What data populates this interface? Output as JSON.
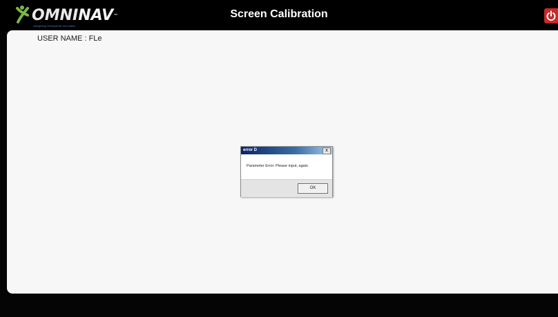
{
  "header": {
    "logo_text_a": "OMNI",
    "logo_text_b": "NAV",
    "logo_tm": "™",
    "logo_tagline": "Navigating Orthopaedic Innovation",
    "title": "Screen Calibration",
    "power_icon": "power-icon"
  },
  "main": {
    "user_label": "USER NAME : FLe"
  },
  "dialog": {
    "title": "error D",
    "close_label": "x",
    "message": "Parameter Error. Please input, again",
    "ok_label": "OK"
  },
  "colors": {
    "header_bg": "#000000",
    "panel_bg": "#f7f7f7",
    "power_button": "#c62a2a",
    "dialog_titlebar": "#0a246a"
  }
}
